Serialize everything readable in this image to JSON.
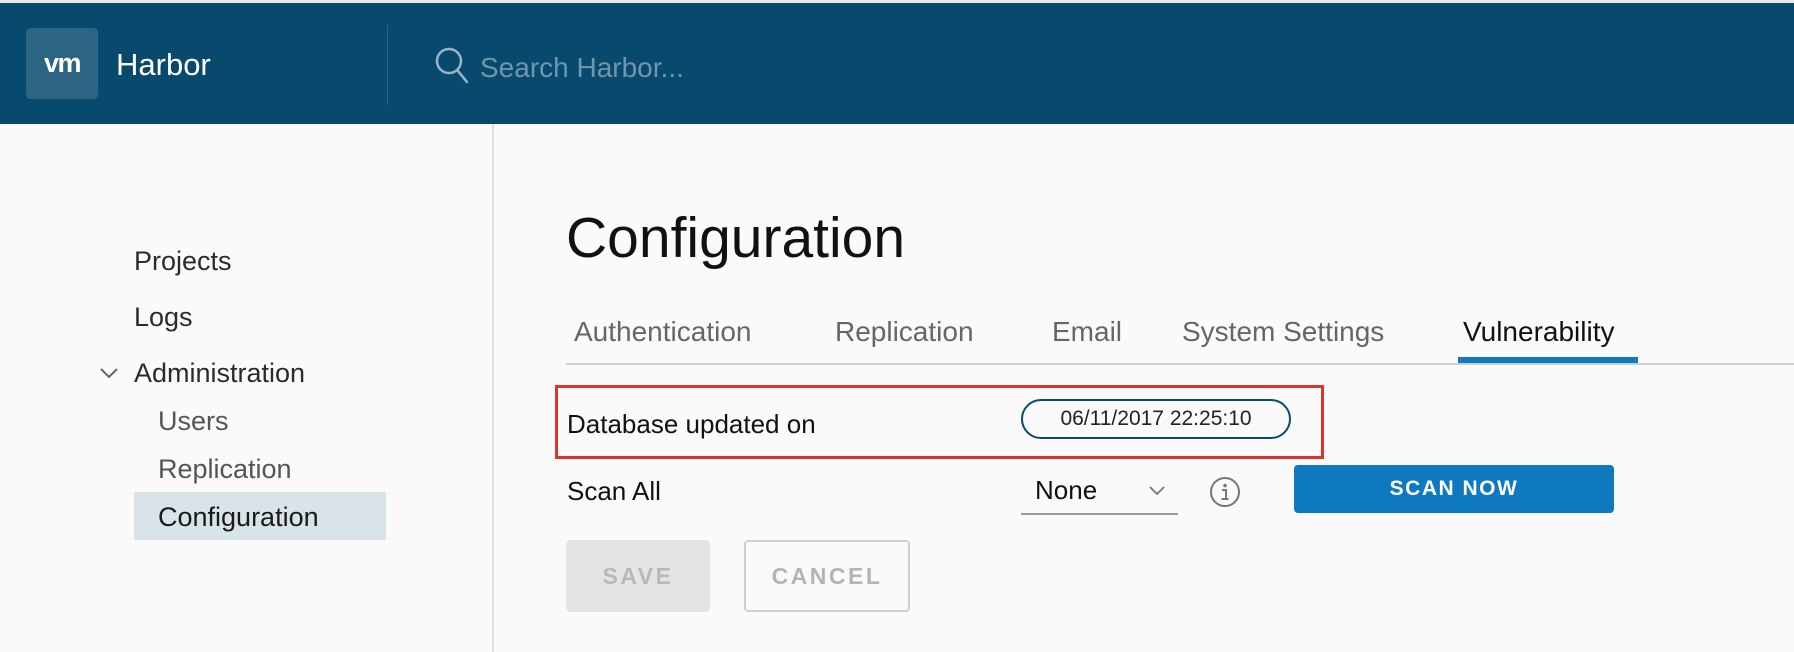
{
  "header": {
    "logo_text": "vm",
    "app_name": "Harbor",
    "search": {
      "placeholder": "Search Harbor...",
      "value": ""
    },
    "colors": {
      "background": "#084a6e",
      "logo_bg": "#2c6584"
    }
  },
  "sidebar": {
    "items": [
      {
        "label": "Projects"
      },
      {
        "label": "Logs"
      },
      {
        "label": "Administration",
        "expanded": true,
        "children": [
          {
            "label": "Users"
          },
          {
            "label": "Replication"
          },
          {
            "label": "Configuration",
            "active": true
          }
        ]
      }
    ],
    "icons": {
      "expand": "chevron-down-icon"
    }
  },
  "main": {
    "title": "Configuration",
    "tabs": [
      {
        "label": "Authentication"
      },
      {
        "label": "Replication"
      },
      {
        "label": "Email"
      },
      {
        "label": "System Settings"
      },
      {
        "label": "Vulnerability",
        "active": true
      }
    ],
    "vulnerability": {
      "db_label": "Database updated on",
      "db_timestamp": "06/11/2017 22:25:10",
      "scan_all_label": "Scan All",
      "scan_all_selected": "None",
      "scan_now_label": "SCAN NOW",
      "info_icon": "info-icon"
    },
    "actions": {
      "save_label": "SAVE",
      "cancel_label": "CANCEL"
    },
    "colors": {
      "accent": "#0f79bf",
      "highlight_border": "#e0332b"
    }
  }
}
